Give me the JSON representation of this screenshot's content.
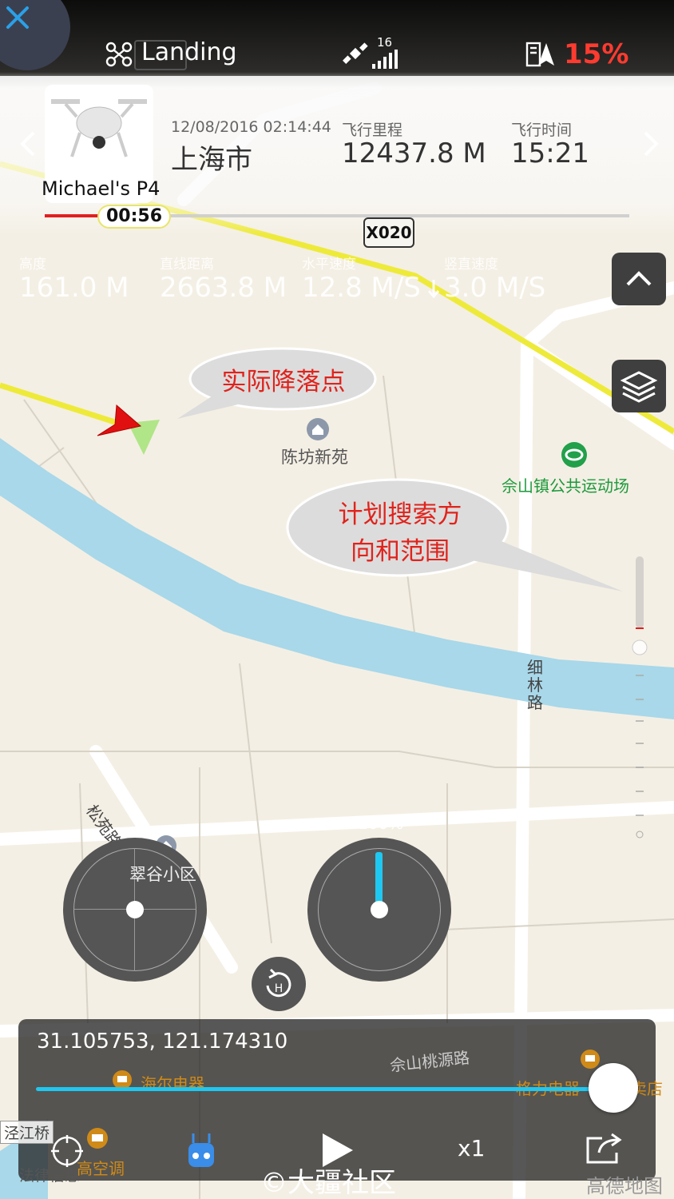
{
  "status": {
    "flight_mode": "Landing",
    "satellite_count": "16",
    "battery_percent": "15%",
    "accent_red": "#ff3b30",
    "icons": [
      "close-icon",
      "drone-icon",
      "satellite-icon",
      "signal-bars-icon",
      "battery-icon"
    ]
  },
  "flight_record": {
    "aircraft_name": "Michael's P4",
    "datetime": "12/08/2016 02:14:44",
    "location": "上海市",
    "distance_label": "飞行里程",
    "distance_value": "12437.8 M",
    "duration_label": "飞行时间",
    "duration_value": "15:21",
    "playback_time": "00:56",
    "playback_progress": 0.1
  },
  "telemetry": {
    "altitude_label": "高度",
    "altitude_value": "161.0 M",
    "distance_label": "直线距离",
    "distance_value": "2663.8 M",
    "hspeed_label": "水平速度",
    "hspeed_value": "12.8 M/S",
    "vspeed_label": "竖直速度",
    "vspeed_value": "3.0 M/S"
  },
  "map": {
    "road_badge": "X020",
    "callout_landing": "实际降落点",
    "callout_search_line1": "计划搜索方",
    "callout_search_line2": "向和范围",
    "poi_chenfang": "陈坊新苑",
    "poi_stadium": "佘山镇公共运动场",
    "road_xilin": "细林路",
    "road_songyuan": "松苑路",
    "poi_cuigu": "翠谷小区",
    "road_taoyuan": "佘山桃源路",
    "poi_haier": "海尔电器",
    "poi_gree": "格力电器",
    "poi_store": "专卖店",
    "poi_bridge": "泾江桥",
    "poi_ac": "高空调",
    "poi_law": "法律信息",
    "throttle_label": "100%",
    "throttle_level": 1.0,
    "provider": "高德地图"
  },
  "playback": {
    "coordinates": "31.105753, 121.174310",
    "speed": "x1",
    "progress": 0.99,
    "watermark": "©大疆社区",
    "accent_blue": "#1ec8f0"
  }
}
